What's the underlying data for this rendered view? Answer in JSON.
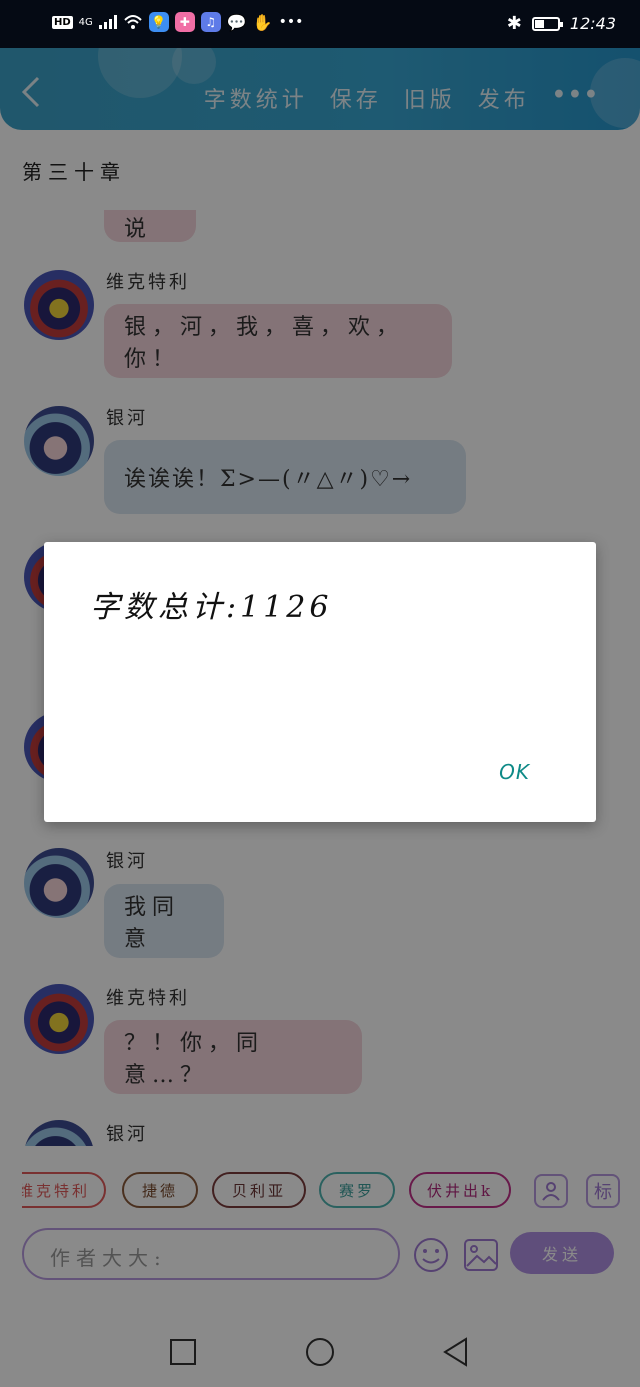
{
  "status_bar": {
    "hd": "HD",
    "network": "4G",
    "time": "12:43",
    "battery_level": 0.4
  },
  "header": {
    "actions": [
      "字数统计",
      "保存",
      "旧版",
      "发布"
    ],
    "more": "•••"
  },
  "chapter_title": "第三十章",
  "chat": {
    "top_partial": "我说",
    "messages": [
      {
        "speaker": "维克特利",
        "text": "银，河，我，喜，欢，你！"
      },
      {
        "speaker": "银河",
        "text": "诶诶诶！Σ>—(〃△〃)♡→"
      },
      {
        "speaker": "银河",
        "text": "我同意"
      },
      {
        "speaker": "维克特利",
        "text": "？！你，同意…？"
      },
      {
        "speaker": "银河",
        "text": ""
      }
    ]
  },
  "characters": [
    "维克特利",
    "捷德",
    "贝利亚",
    "赛罗",
    "伏井出k"
  ],
  "character_colors": [
    "#e05b5b",
    "#8a5a3a",
    "#7a3c3c",
    "#4fb3b0",
    "#c0308a"
  ],
  "input": {
    "placeholder": "作者大大:"
  },
  "send_label": "发送",
  "tag_label": "标",
  "dialog": {
    "message": "字数总计:1126",
    "ok_label": "OK"
  }
}
